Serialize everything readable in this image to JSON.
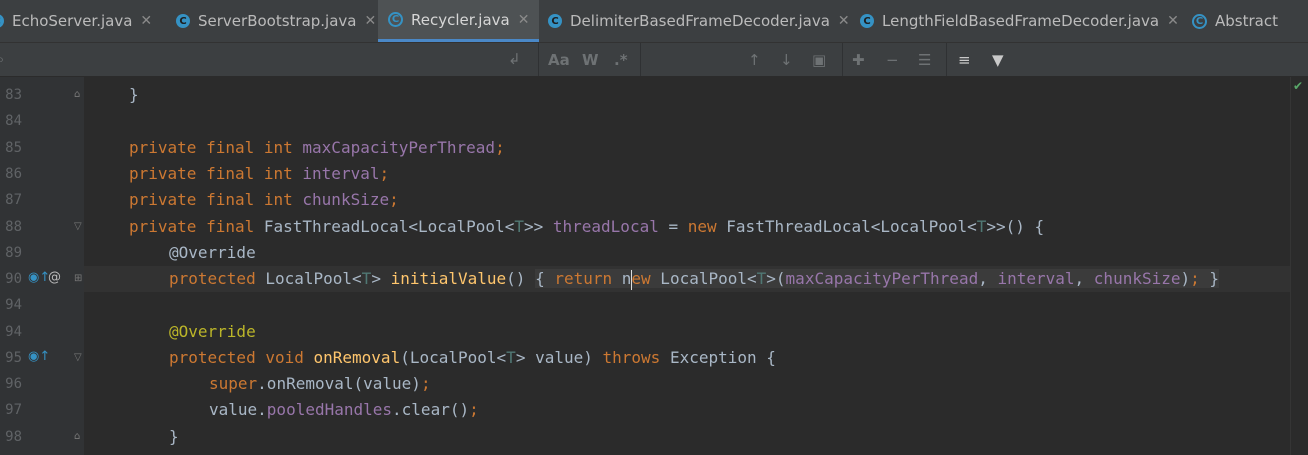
{
  "tabs": [
    {
      "label": "EchoServer.java",
      "active": false,
      "icon": "class-c-icon"
    },
    {
      "label": "ServerBootstrap.java",
      "active": false,
      "icon": "class-c-icon"
    },
    {
      "label": "Recycler.java",
      "active": true,
      "icon": "abstract-class-icon"
    },
    {
      "label": "DelimiterBasedFrameDecoder.java",
      "active": false,
      "icon": "class-c-icon"
    },
    {
      "label": "LengthFieldBasedFrameDecoder.java",
      "active": false,
      "icon": "class-c-icon"
    },
    {
      "label": "Abstract",
      "active": false,
      "icon": "abstract-class-icon"
    }
  ],
  "search": {
    "match_case": "Aa",
    "words": "W",
    "regex": ".*",
    "icons": [
      "search-icon",
      "new-line-icon",
      "prev-occurrence-icon",
      "next-occurrence-icon",
      "select-all-icon",
      "add-selection-icon",
      "remove-selection-icon",
      "select-all-occurrences-icon",
      "multiline-icon",
      "filter-icon"
    ]
  },
  "editor": {
    "accent": "#4a88c7",
    "lines": [
      {
        "n": "83",
        "text": "}"
      },
      {
        "n": "84",
        "text": ""
      },
      {
        "n": "85",
        "text": "private final int maxCapacityPerThread;"
      },
      {
        "n": "86",
        "text": "private final int interval;"
      },
      {
        "n": "87",
        "text": "private final int chunkSize;"
      },
      {
        "n": "88",
        "text": "private final FastThreadLocal<LocalPool<T>> threadLocal = new FastThreadLocal<LocalPool<T>>() {"
      },
      {
        "n": "89",
        "text": "@Override"
      },
      {
        "n": "90",
        "text": "protected LocalPool<T> initialValue() { return new LocalPool<T>(maxCapacityPerThread, interval, chunkSize); }"
      },
      {
        "n": "94",
        "text": ""
      },
      {
        "n": "94",
        "text": "@Override"
      },
      {
        "n": "95",
        "text": "protected void onRemoval(LocalPool<T> value) throws Exception {"
      },
      {
        "n": "96",
        "text": "super.onRemoval(value);"
      },
      {
        "n": "97",
        "text": "value.pooledHandles.clear();"
      },
      {
        "n": "98",
        "text": "}"
      }
    ],
    "gutter_marks": {
      "override_symbol": "@",
      "override_icon": "overrides-method-icon"
    },
    "status_check": "✔"
  }
}
